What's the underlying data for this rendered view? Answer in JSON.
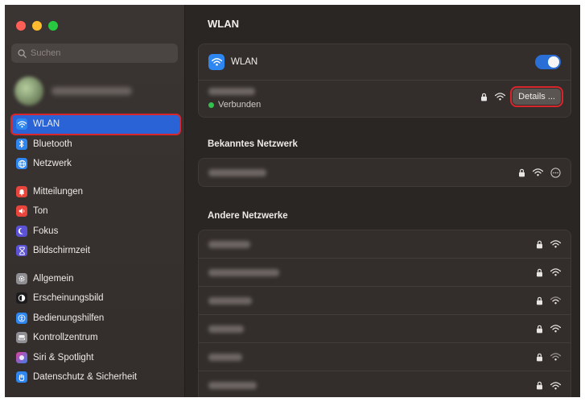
{
  "window": {
    "title": "WLAN"
  },
  "sidebar": {
    "search_placeholder": "Suchen",
    "groups": [
      [
        {
          "label": "WLAN",
          "icon": "wifi-icon",
          "color": "#2e86f0",
          "active": true
        },
        {
          "label": "Bluetooth",
          "icon": "bluetooth-icon",
          "color": "#2e86f0"
        },
        {
          "label": "Netzwerk",
          "icon": "globe-icon",
          "color": "#2e86f0"
        }
      ],
      [
        {
          "label": "Mitteilungen",
          "icon": "bell-icon",
          "color": "#e8453c"
        },
        {
          "label": "Ton",
          "icon": "speaker-icon",
          "color": "#e8453c"
        },
        {
          "label": "Fokus",
          "icon": "moon-icon",
          "color": "#5b52d6"
        },
        {
          "label": "Bildschirmzeit",
          "icon": "hourglass-icon",
          "color": "#5b52d6"
        }
      ],
      [
        {
          "label": "Allgemein",
          "icon": "gear-icon",
          "color": "#8e8e93"
        },
        {
          "label": "Erscheinungsbild",
          "icon": "appearance-icon",
          "color": "#1c1c1e"
        },
        {
          "label": "Bedienungshilfen",
          "icon": "accessibility-icon",
          "color": "#2e86f0"
        },
        {
          "label": "Kontrollzentrum",
          "icon": "control-center-icon",
          "color": "#8e8e93"
        },
        {
          "label": "Siri & Spotlight",
          "icon": "siri-icon",
          "color": "#7a3fd0"
        },
        {
          "label": "Datenschutz & Sicherheit",
          "icon": "hand-icon",
          "color": "#2e86f0"
        }
      ]
    ]
  },
  "main": {
    "title": "WLAN",
    "wlan_row_label": "WLAN",
    "wlan_enabled": true,
    "connected_status": "Verbunden",
    "details_button": "Details ...",
    "known_section": "Bekanntes Netzwerk",
    "other_section": "Andere Netzwerke",
    "other_networks_count": 6
  },
  "colors": {
    "accent": "#2a63d6",
    "highlight_border": "#d8262b",
    "connected": "#32c14c"
  }
}
